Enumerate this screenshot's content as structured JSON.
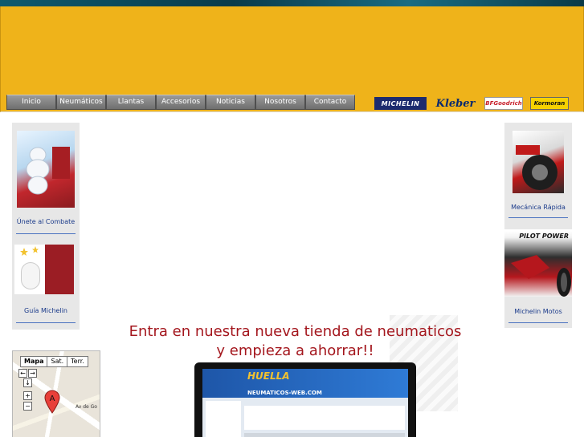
{
  "nav": {
    "items": [
      "Inicio",
      "Neumáticos",
      "Llantas",
      "Accesorios",
      "Noticias",
      "Nosotros",
      "Contacto"
    ]
  },
  "brands": {
    "michelin": "MICHELIN",
    "kleber": "Kleber",
    "bfgoodrich": "BFGoodrich",
    "kormoran": "Kormoran"
  },
  "sidebar_left": {
    "combate_caption": "Únete al Combate",
    "guia_caption": "Guía Michelin"
  },
  "sidebar_right": {
    "mecanica_caption": "Mecánica Rápida",
    "pilot_text": "PILOT POWER",
    "motos_caption": "Michelin Motos"
  },
  "promo": {
    "line1": "Entra en nuestra nueva tienda de neumaticos",
    "line2": "y empieza a ahorrar!!",
    "site_title": "HUELLA",
    "site_url": "NEUMATICOS-WEB.COM"
  },
  "map": {
    "tab_map": "Mapa",
    "tab_sat": "Sat.",
    "tab_terr": "Terr.",
    "road": "Av de Go"
  },
  "colors": {
    "header": "#efb31a",
    "nav_button": "#7d7d7d",
    "promo_text": "#a4171e",
    "caption_link": "#1a3a8a"
  }
}
